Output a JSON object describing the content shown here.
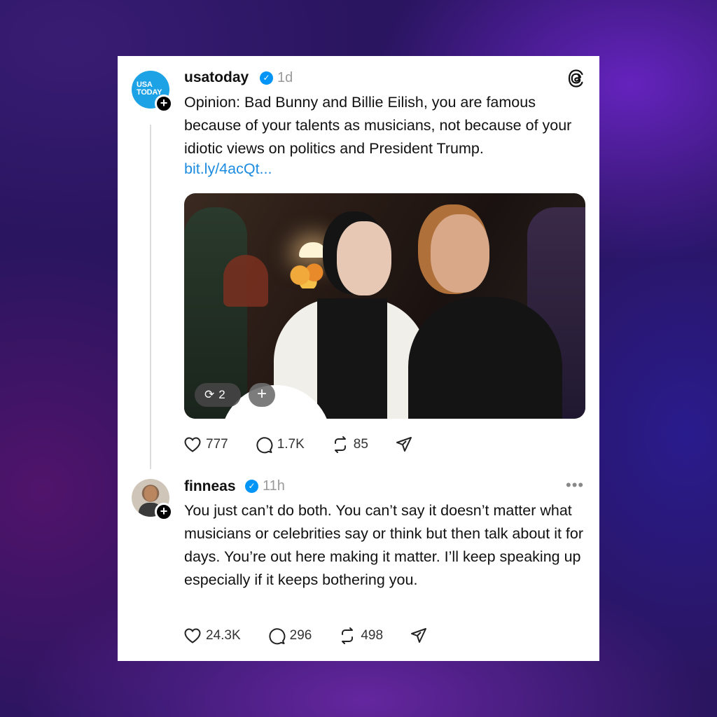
{
  "post1": {
    "avatar_text": "USA TODAY",
    "username": "usatoday",
    "time": "1d",
    "text": "Opinion: Bad Bunny and Billie Eilish, you are famous because of your talents as musicians, not because of your idiotic views on politics and President Trump.",
    "link": "bit.ly/4acQt...",
    "repost_pill_count": "2",
    "likes": "777",
    "comments": "1.7K",
    "reposts": "85"
  },
  "post2": {
    "username": "finneas",
    "time": "11h",
    "text": "You just can’t do both. You can’t say it doesn’t matter what musicians or celebrities say or think but then talk about it for days. You’re out here making it matter. I’ll keep speaking up especially if it keeps bothering you.",
    "likes": "24.3K",
    "comments": "296",
    "reposts": "498"
  },
  "icons": [
    "threads-logo-icon",
    "verified-icon",
    "plus-icon",
    "heart-icon",
    "comment-icon",
    "repost-icon",
    "share-icon",
    "more-icon"
  ],
  "colors": {
    "verified": "#0095f6",
    "link": "#1d8ce0",
    "usa_today_blue": "#1ea2e6"
  }
}
